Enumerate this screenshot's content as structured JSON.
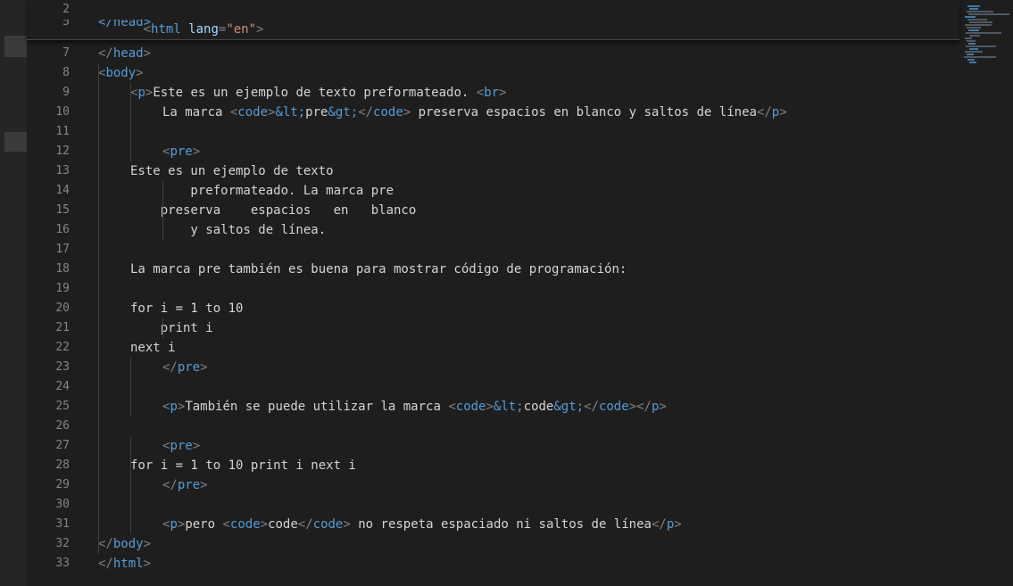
{
  "sticky_scroll": {
    "lines": [
      {
        "number": "2",
        "html_open": "<",
        "tag": "html",
        "attr": "lang",
        "eq": "=",
        "value": "\"en\"",
        "close": ">"
      },
      {
        "number": "5",
        "partial_text": "</head>"
      }
    ]
  },
  "lines": [
    {
      "n": "7",
      "indent": 0,
      "parts": [
        [
          "punc",
          "</"
        ],
        [
          "tag",
          "head"
        ],
        [
          "punc",
          ">"
        ]
      ]
    },
    {
      "n": "8",
      "indent": 0,
      "parts": [
        [
          "punc",
          "<"
        ],
        [
          "tag",
          "body"
        ],
        [
          "punc",
          ">"
        ]
      ]
    },
    {
      "n": "9",
      "indent": 1,
      "parts": [
        [
          "punc",
          "<"
        ],
        [
          "tag",
          "p"
        ],
        [
          "punc",
          ">"
        ],
        [
          "text",
          "Este es un ejemplo de texto preformateado. "
        ],
        [
          "punc",
          "<"
        ],
        [
          "tag",
          "br"
        ],
        [
          "punc",
          ">"
        ]
      ]
    },
    {
      "n": "10",
      "indent": 2,
      "parts": [
        [
          "text",
          "La marca "
        ],
        [
          "punc",
          "<"
        ],
        [
          "tag",
          "code"
        ],
        [
          "punc",
          ">"
        ],
        [
          "tag",
          "&lt;"
        ],
        [
          "text",
          "pre"
        ],
        [
          "tag",
          "&gt;"
        ],
        [
          "punc",
          "</"
        ],
        [
          "tag",
          "code"
        ],
        [
          "punc",
          ">"
        ],
        [
          "text",
          " preserva espacios en blanco y saltos de línea"
        ],
        [
          "punc",
          "</"
        ],
        [
          "tag",
          "p"
        ],
        [
          "punc",
          ">"
        ]
      ]
    },
    {
      "n": "11",
      "indent": 0,
      "parts": []
    },
    {
      "n": "12",
      "indent": 2,
      "parts": [
        [
          "punc",
          "<"
        ],
        [
          "tag",
          "pre"
        ],
        [
          "punc",
          ">"
        ]
      ]
    },
    {
      "n": "13",
      "indent": 1,
      "parts": [
        [
          "text",
          "Este es un ejemplo de texto"
        ]
      ]
    },
    {
      "n": "14",
      "indent": 1,
      "parts": [
        [
          "text",
          "        preformateado. La marca pre"
        ]
      ]
    },
    {
      "n": "15",
      "indent": 1,
      "parts": [
        [
          "text",
          "    preserva    espacios   en   blanco"
        ]
      ]
    },
    {
      "n": "16",
      "indent": 1,
      "parts": [
        [
          "text",
          "        y saltos de línea."
        ]
      ]
    },
    {
      "n": "17",
      "indent": 0,
      "parts": []
    },
    {
      "n": "18",
      "indent": 1,
      "parts": [
        [
          "text",
          "La marca pre también es buena para mostrar código de programación:"
        ]
      ]
    },
    {
      "n": "19",
      "indent": 0,
      "parts": []
    },
    {
      "n": "20",
      "indent": 1,
      "parts": [
        [
          "text",
          "for i = 1 to 10"
        ]
      ]
    },
    {
      "n": "21",
      "indent": 1,
      "parts": [
        [
          "text",
          "    print i"
        ]
      ]
    },
    {
      "n": "22",
      "indent": 1,
      "parts": [
        [
          "text",
          "next i"
        ]
      ]
    },
    {
      "n": "23",
      "indent": 2,
      "parts": [
        [
          "punc",
          "</"
        ],
        [
          "tag",
          "pre"
        ],
        [
          "punc",
          ">"
        ]
      ]
    },
    {
      "n": "24",
      "indent": 0,
      "parts": []
    },
    {
      "n": "25",
      "indent": 2,
      "parts": [
        [
          "punc",
          "<"
        ],
        [
          "tag",
          "p"
        ],
        [
          "punc",
          ">"
        ],
        [
          "text",
          "También se puede utilizar la marca "
        ],
        [
          "punc",
          "<"
        ],
        [
          "tag",
          "code"
        ],
        [
          "punc",
          ">"
        ],
        [
          "tag",
          "&lt;"
        ],
        [
          "text",
          "code"
        ],
        [
          "tag",
          "&gt;"
        ],
        [
          "punc",
          "</"
        ],
        [
          "tag",
          "code"
        ],
        [
          "punc",
          ">"
        ],
        [
          "punc",
          "</"
        ],
        [
          "tag",
          "p"
        ],
        [
          "punc",
          ">"
        ]
      ]
    },
    {
      "n": "26",
      "indent": 0,
      "parts": []
    },
    {
      "n": "27",
      "indent": 2,
      "parts": [
        [
          "punc",
          "<"
        ],
        [
          "tag",
          "pre"
        ],
        [
          "punc",
          ">"
        ]
      ]
    },
    {
      "n": "28",
      "indent": 1,
      "parts": [
        [
          "text",
          "for i = 1 to 10 print i next i"
        ]
      ]
    },
    {
      "n": "29",
      "indent": 2,
      "parts": [
        [
          "punc",
          "</"
        ],
        [
          "tag",
          "pre"
        ],
        [
          "punc",
          ">"
        ]
      ]
    },
    {
      "n": "30",
      "indent": 0,
      "parts": []
    },
    {
      "n": "31",
      "indent": 2,
      "parts": [
        [
          "punc",
          "<"
        ],
        [
          "tag",
          "p"
        ],
        [
          "punc",
          ">"
        ],
        [
          "text",
          "pero "
        ],
        [
          "punc",
          "<"
        ],
        [
          "tag",
          "code"
        ],
        [
          "punc",
          ">"
        ],
        [
          "text",
          "code"
        ],
        [
          "punc",
          "</"
        ],
        [
          "tag",
          "code"
        ],
        [
          "punc",
          ">"
        ],
        [
          "text",
          " no respeta espaciado ni saltos de línea"
        ],
        [
          "punc",
          "</"
        ],
        [
          "tag",
          "p"
        ],
        [
          "punc",
          ">"
        ]
      ]
    },
    {
      "n": "32",
      "indent": 0,
      "parts": [
        [
          "punc",
          "</"
        ],
        [
          "tag",
          "body"
        ],
        [
          "punc",
          ">"
        ]
      ]
    },
    {
      "n": "33",
      "indent": 0,
      "parts": [
        [
          "punc",
          "</"
        ],
        [
          "tag",
          "html"
        ],
        [
          "punc",
          ">"
        ]
      ]
    }
  ],
  "colors": {
    "background": "#1e1e1e",
    "tag": "#569cd6",
    "bracket": "#808080",
    "attribute": "#9cdcfe",
    "string": "#ce9178",
    "text": "#d4d4d4",
    "line_number": "#858585"
  }
}
